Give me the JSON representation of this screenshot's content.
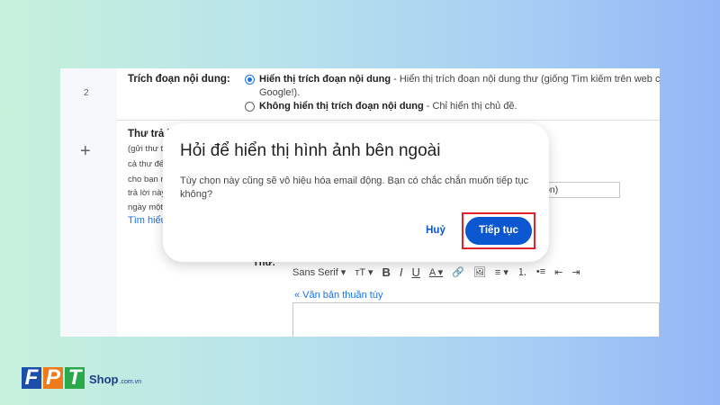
{
  "settings": {
    "row_number": "2",
    "snippet_label": "Trích đoạn nội dung:",
    "option_show_bold": "Hiển thị trích đoạn nội dung",
    "option_show_desc": " - Hiển thị trích đoạn nội dung thư (giống Tìm kiếm trên web củ",
    "option_show_desc_2": "Google!).",
    "option_hide_bold": "Không hiển thị trích đoạn nội dung",
    "option_hide_desc": " - Chỉ hiển thị chủ đề.",
    "reply_label": "Thư trả l",
    "reply_lines": [
      "(gửi thư t",
      "cả thư đế",
      "cho bạn r",
      "trả lời này",
      "ngày một"
    ],
    "learn_more": "Tìm hiểu",
    "select_value": "chọn)",
    "thu_label": "Thư:",
    "toolbar": {
      "font": "Sans Serif ▾",
      "size": "тT ▾",
      "bold": "B",
      "italic": "I",
      "underline": "U",
      "color": "A ▾",
      "link": "🔗",
      "image": "🖼",
      "align": "≡ ▾",
      "ol": "⒈",
      "ul": "•≡",
      "indent": "⇤",
      "outdent": "⇥"
    },
    "plain_text_link": "« Văn bản thuần túy",
    "plus_icon": "+"
  },
  "dialog": {
    "title": "Hỏi để hiển thị hình ảnh bên ngoài",
    "body": "Tùy chọn này cũng sẽ vô hiệu hóa email động. Bạn có chắc chắn muốn tiếp tục không?",
    "cancel_label": "Huỷ",
    "continue_label": "Tiếp tục",
    "highlight_color": "#e0242a",
    "primary_color": "#0b57d0"
  },
  "brand": {
    "letters": [
      "F",
      "P",
      "T"
    ],
    "letter_colors": [
      "#1e4fa8",
      "#f07a1a",
      "#2aa84a"
    ],
    "shop": "Shop",
    "domain": ".com.vn"
  }
}
